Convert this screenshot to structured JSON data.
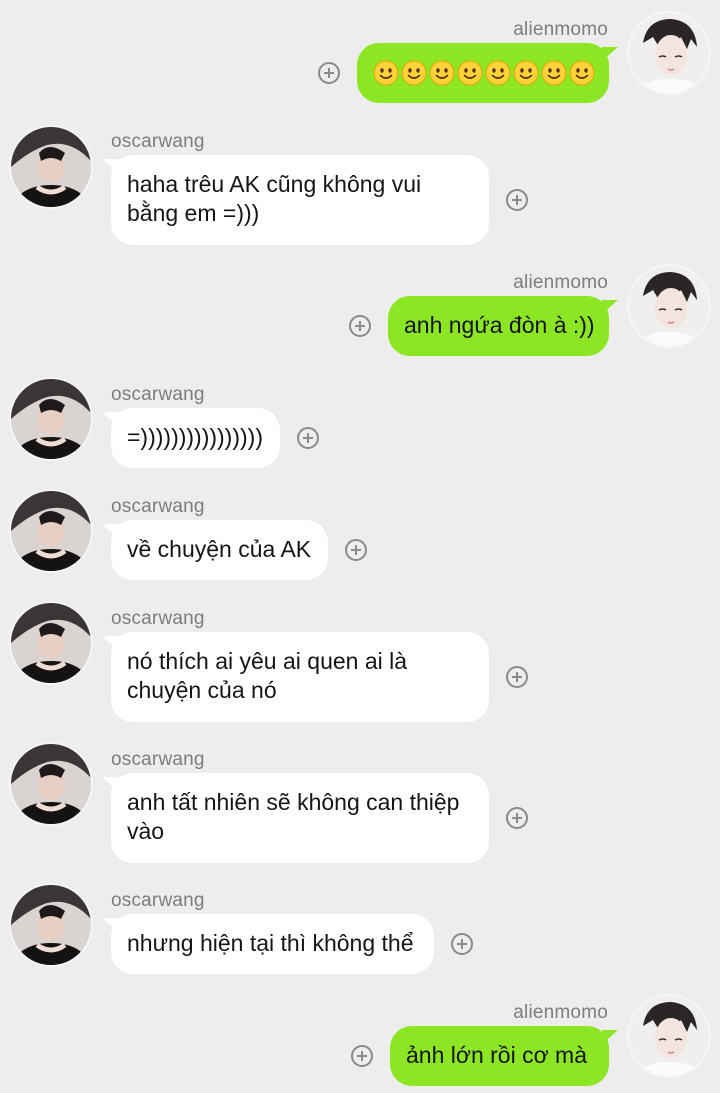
{
  "chat": {
    "messages": [
      {
        "sender": "alienmomo",
        "side": "out",
        "emoji": "slightly-smiling-face",
        "emoji_count": 8
      },
      {
        "sender": "oscarwang",
        "side": "in",
        "text_lines": [
          "haha trêu AK cũng không vui",
          "bằng em =)))"
        ]
      },
      {
        "sender": "alienmomo",
        "side": "out",
        "text_lines": [
          "anh ngứa đòn à :))"
        ]
      },
      {
        "sender": "oscarwang",
        "side": "in",
        "text_lines": [
          "=))))))))))))))))"
        ]
      },
      {
        "sender": "oscarwang",
        "side": "in",
        "text_lines": [
          "về chuyện của AK"
        ]
      },
      {
        "sender": "oscarwang",
        "side": "in",
        "text_lines": [
          "nó thích ai yêu ai quen ai là",
          "chuyện của nó"
        ]
      },
      {
        "sender": "oscarwang",
        "side": "in",
        "text_lines": [
          "anh tất nhiên sẽ không can thiệp",
          "vào"
        ]
      },
      {
        "sender": "oscarwang",
        "side": "in",
        "text_lines": [
          "nhưng hiện tại thì không thể"
        ]
      },
      {
        "sender": "alienmomo",
        "side": "out",
        "text_lines": [
          "ảnh lớn rồi cơ mà"
        ]
      }
    ]
  },
  "colors": {
    "background": "#ededed",
    "outgoing_bubble": "#8ce624",
    "incoming_bubble": "#ffffff",
    "sender_name": "#7d7d7d"
  },
  "icons": {
    "add": "plus-circle-icon",
    "emoji": "slightly-smiling-face"
  }
}
